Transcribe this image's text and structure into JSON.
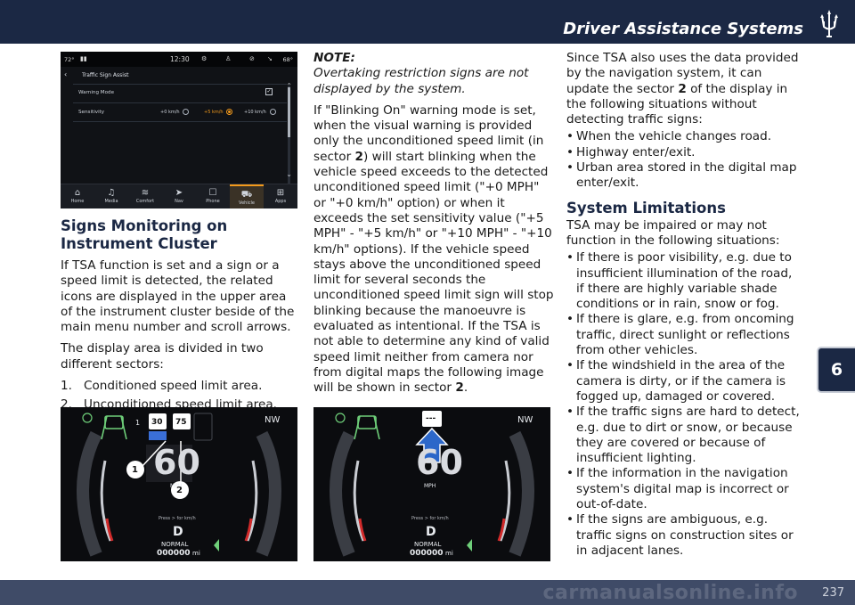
{
  "header": {
    "title": "Driver Assistance Systems"
  },
  "chapter_tab": "6",
  "footer": {
    "page_number": "237",
    "watermark": "carmanualsonline.info"
  },
  "ui_screen": {
    "status": {
      "temp_left": "72°",
      "clock": "12:30",
      "temp_right": "68°"
    },
    "title": "Traffic Sign Assist",
    "rows": {
      "warning_mode": "Warning Mode",
      "sensitivity": "Sensitivity",
      "options": [
        "+0 km/h",
        "+5 km/h",
        "+10 km/h"
      ],
      "selected_option": "+5 km/h"
    },
    "nav": [
      "Home",
      "Media",
      "Comfort",
      "Nav",
      "Phone",
      "Vehicle",
      "Apps"
    ],
    "nav_active": "Vehicle",
    "accent_color": "#f39a1c"
  },
  "col1": {
    "heading": "Signs Monitoring on Instrument Cluster",
    "p1": "If TSA function is set and a sign or a speed limit is detected, the related icons are displayed in the upper area of the instrument cluster beside of the main menu number and scroll arrows.",
    "p2": "The display area is divided in two different sectors:",
    "list": [
      {
        "num": "1.",
        "text": "Conditioned speed limit area."
      },
      {
        "num": "2.",
        "text": "Unconditioned speed limit area."
      }
    ]
  },
  "col2": {
    "note_title": "NOTE:",
    "note_body": "Overtaking restriction signs are not displayed by the system.",
    "p1_before": "If \"Blinking On\" warning mode is set, when the visual warning is provided only the unconditioned speed limit (in sector ",
    "p1_sector": "2",
    "p1_after": ") will start blinking when the vehicle speed exceeds to the detected unconditioned speed limit (\"+0 MPH\" or \"+0 km/h\" option) or when it exceeds the set sensitivity value (\"+5 MPH\" - \"+5 km/h\" or \"+10 MPH\" - \"+10 km/h\" options). If the vehicle speed stays above the unconditioned speed limit for several seconds the unconditioned speed limit sign will stop blinking because the manoeuvre is evaluated as intentional. If the TSA is not able to determine any kind of valid speed limit neither from camera nor from digital maps the following image will be shown in sector ",
    "p1_sector_end": "2",
    "p1_end": "."
  },
  "col3": {
    "p1_before": "Since TSA also uses the data provided by the navigation system, it can update the sector ",
    "p1_sector": "2",
    "p1_after": " of the display in the following situations without detecting traffic signs:",
    "bullets1": [
      "When the vehicle changes road.",
      "Highway enter/exit.",
      "Urban area stored in the digital map enter/exit."
    ],
    "heading": "System Limitations",
    "p2": "TSA may be impaired or may not function in the following situations:",
    "bullets2": [
      "If there is poor visibility, e.g. due to insufficient illumination of the road, if there are highly variable shade conditions or in rain, snow or fog.",
      "If there is glare, e.g. from oncoming traffic, direct sunlight or reflections from other vehicles.",
      "If the windshield in the area of the camera is dirty, or if the camera is fogged up, damaged or covered.",
      "If the traffic signs are hard to detect, e.g. due to dirt or snow, or because they are covered or because of insufficient lighting.",
      "If the information in the navigation system's digital map is incorrect or out-of-date.",
      "If the signs are ambiguous, e.g. traffic signs on construction sites or in adjacent lanes."
    ]
  },
  "cluster1": {
    "speed": "60",
    "unit": "MPH",
    "sign_a": "30",
    "sign_b": "75",
    "heading": "NW",
    "gear": "D",
    "mode": "NORMAL",
    "odo": "000000",
    "odo_unit": "mi",
    "hint": "Press  >  for km/h",
    "callout1": "1",
    "callout2": "2",
    "menu_num": "1"
  },
  "cluster2": {
    "speed": "60",
    "unit": "MPH",
    "sign": "---",
    "heading": "NW",
    "gear": "D",
    "mode": "NORMAL",
    "odo": "000000",
    "odo_unit": "mi",
    "hint": "Press  >  for km/h"
  }
}
